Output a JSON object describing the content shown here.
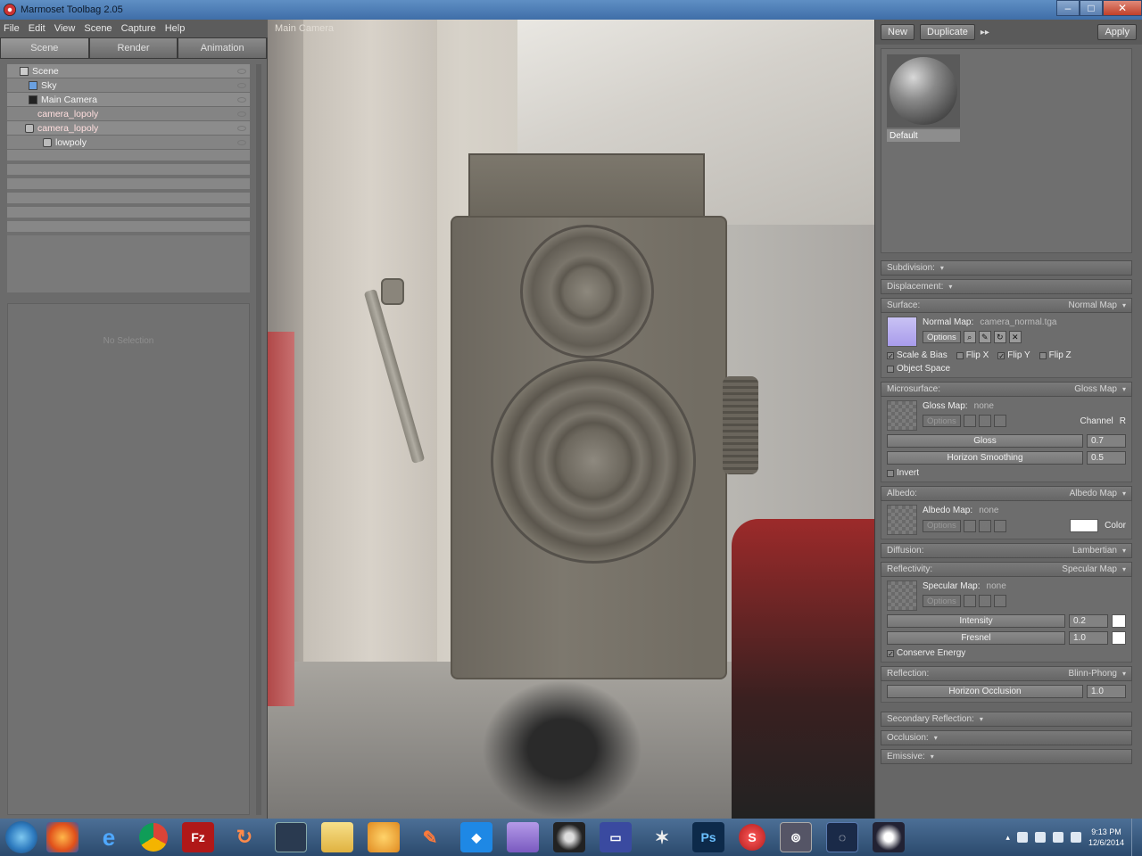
{
  "window": {
    "title": "Marmoset Toolbag 2.05"
  },
  "menu": [
    "File",
    "Edit",
    "View",
    "Scene",
    "Capture",
    "Help"
  ],
  "left_tabs": [
    "Scene",
    "Render",
    "Animation"
  ],
  "outliner": [
    {
      "label": "Scene",
      "icon": "scene-icon"
    },
    {
      "label": "Sky",
      "icon": "sky-icon"
    },
    {
      "label": "Main Camera",
      "icon": "camera-icon"
    },
    {
      "label": "camera_lopoly",
      "icon": "mesh-icon"
    },
    {
      "label": "camera_lopoly",
      "icon": "mesh-icon"
    },
    {
      "label": "lowpoly",
      "icon": "mesh-icon"
    }
  ],
  "props": {
    "empty_text": "No Selection"
  },
  "viewport": {
    "label": "Main Camera"
  },
  "material": {
    "toolbar": {
      "new": "New",
      "duplicate": "Duplicate",
      "apply": "Apply"
    },
    "thumb_name": "Default",
    "sections": {
      "subdivision": "Subdivision:",
      "displacement": "Displacement:",
      "surface": {
        "title": "Surface:",
        "mode": "Normal Map",
        "map_label": "Normal Map:",
        "map_value": "camera_normal.tga",
        "options": "Options",
        "checks": [
          "Scale & Bias",
          "Flip X",
          "Flip Y",
          "Flip Z"
        ],
        "object_space": "Object Space"
      },
      "microsurface": {
        "title": "Microsurface:",
        "mode": "Gloss Map",
        "map_label": "Gloss Map:",
        "map_value": "none",
        "options": "Options",
        "channel": "Channel",
        "channel_value": "R",
        "gloss_label": "Gloss",
        "gloss_value": "0.7",
        "horizon_label": "Horizon Smoothing",
        "horizon_value": "0.5",
        "invert": "Invert"
      },
      "albedo": {
        "title": "Albedo:",
        "mode": "Albedo Map",
        "map_label": "Albedo Map:",
        "map_value": "none",
        "options": "Options",
        "color_label": "Color"
      },
      "diffusion": {
        "title": "Diffusion:",
        "mode": "Lambertian"
      },
      "reflectivity": {
        "title": "Reflectivity:",
        "mode": "Specular Map",
        "map_label": "Specular Map:",
        "map_value": "none",
        "options": "Options",
        "intensity_label": "Intensity",
        "intensity_value": "0.2",
        "fresnel_label": "Fresnel",
        "fresnel_value": "1.0",
        "conserve": "Conserve Energy"
      },
      "reflection": {
        "title": "Reflection:",
        "mode": "Blinn-Phong",
        "horizon_label": "Horizon Occlusion",
        "horizon_value": "1.0"
      },
      "secondary": "Secondary Reflection:",
      "occlusion": "Occlusion:",
      "emissive": "Emissive:"
    }
  },
  "taskbar": {
    "clock_time": "9:13 PM",
    "clock_date": "12/6/2014"
  },
  "colors": {
    "titlebar": "#4f7fb8",
    "panel": "#666666",
    "normal_swatch": "#b8aef0"
  }
}
